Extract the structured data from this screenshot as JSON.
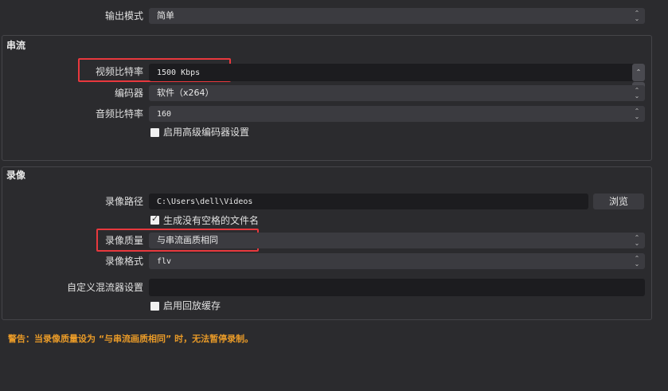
{
  "output_mode": {
    "label": "输出模式",
    "value": "简单"
  },
  "streaming": {
    "title": "串流",
    "video_bitrate": {
      "label": "视频比特率",
      "value": "1500 Kbps"
    },
    "encoder": {
      "label": "编码器",
      "value": "软件（x264）"
    },
    "audio_bitrate": {
      "label": "音频比特率",
      "value": "160"
    },
    "advanced_encoder": {
      "label": "启用高级编码器设置",
      "checked": false
    }
  },
  "recording": {
    "title": "录像",
    "path": {
      "label": "录像路径",
      "value": "C:\\Users\\dell\\Videos",
      "browse": "浏览"
    },
    "no_space_filename": {
      "label": "生成没有空格的文件名",
      "checked": true
    },
    "quality": {
      "label": "录像质量",
      "value": "与串流画质相同"
    },
    "format": {
      "label": "录像格式",
      "value": "flv"
    },
    "muxer": {
      "label": "自定义混流器设置",
      "value": ""
    },
    "replay_buffer": {
      "label": "启用回放缓存",
      "checked": false
    }
  },
  "warning": "警告：当录像质量设为 “与串流画质相同” 时，无法暂停录制。",
  "colors": {
    "highlight": "#e8383d",
    "warning": "#e89a28"
  }
}
